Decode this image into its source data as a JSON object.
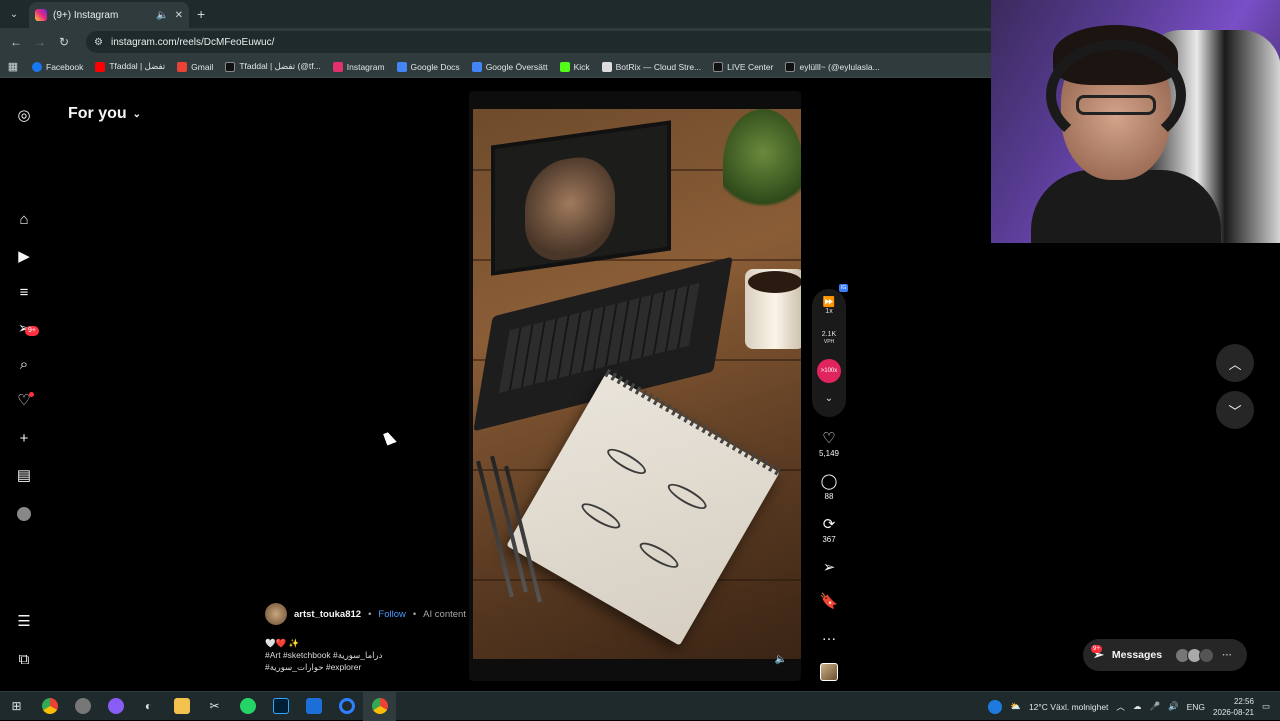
{
  "browser": {
    "tab_title": "(9+) Instagram",
    "url": "instagram.com/reels/DcMFeoEuwuc/",
    "bookmarks": [
      {
        "label": "Facebook",
        "color": "#1877f2"
      },
      {
        "label": "Tfaddal | تفضل",
        "color": "#ff0000"
      },
      {
        "label": "Gmail",
        "color": "#ea4335"
      },
      {
        "label": "Tfaddal | تفضل (@tf...",
        "color": "#000000"
      },
      {
        "label": "Instagram",
        "color": "#e1306c"
      },
      {
        "label": "Google Docs",
        "color": "#4285f4"
      },
      {
        "label": "Google Översätt",
        "color": "#4285f4"
      },
      {
        "label": "Kick",
        "color": "#53fc18"
      },
      {
        "label": "BotRix — Cloud Stre...",
        "color": "#ffffff"
      },
      {
        "label": "LIVE Center",
        "color": "#000000"
      },
      {
        "label": "eylülll~ (@eylulasla...",
        "color": "#000000"
      }
    ]
  },
  "sidebar": {
    "badges": {
      "notifications": "9+"
    }
  },
  "feed": {
    "title": "For you"
  },
  "reel": {
    "author": "artst_touka812",
    "follow_label": "Follow",
    "ai_label": "AI content",
    "caption_line1": "🤍❤️ ✨",
    "caption_line2": "#Art #sketchbook #دراما_سورية",
    "caption_line3": "#حوارات_سورية #explorer",
    "speed": "1x",
    "vph_value": "2.1K",
    "vph_label": "VPH",
    "boost_label": ">100x",
    "likes": "5,149",
    "comments": "88",
    "reposts": "367",
    "ext_tag": "IG"
  },
  "messages": {
    "label": "Messages",
    "badge": "9+"
  },
  "taskbar": {
    "weather": "12°C  Växl. molnighet",
    "lang": "ENG",
    "time": "22:56",
    "date": "2026-08-21"
  },
  "colors": {
    "accent_link": "#4a9bff",
    "badge": "#ff3040",
    "boost": "#e0245e"
  }
}
